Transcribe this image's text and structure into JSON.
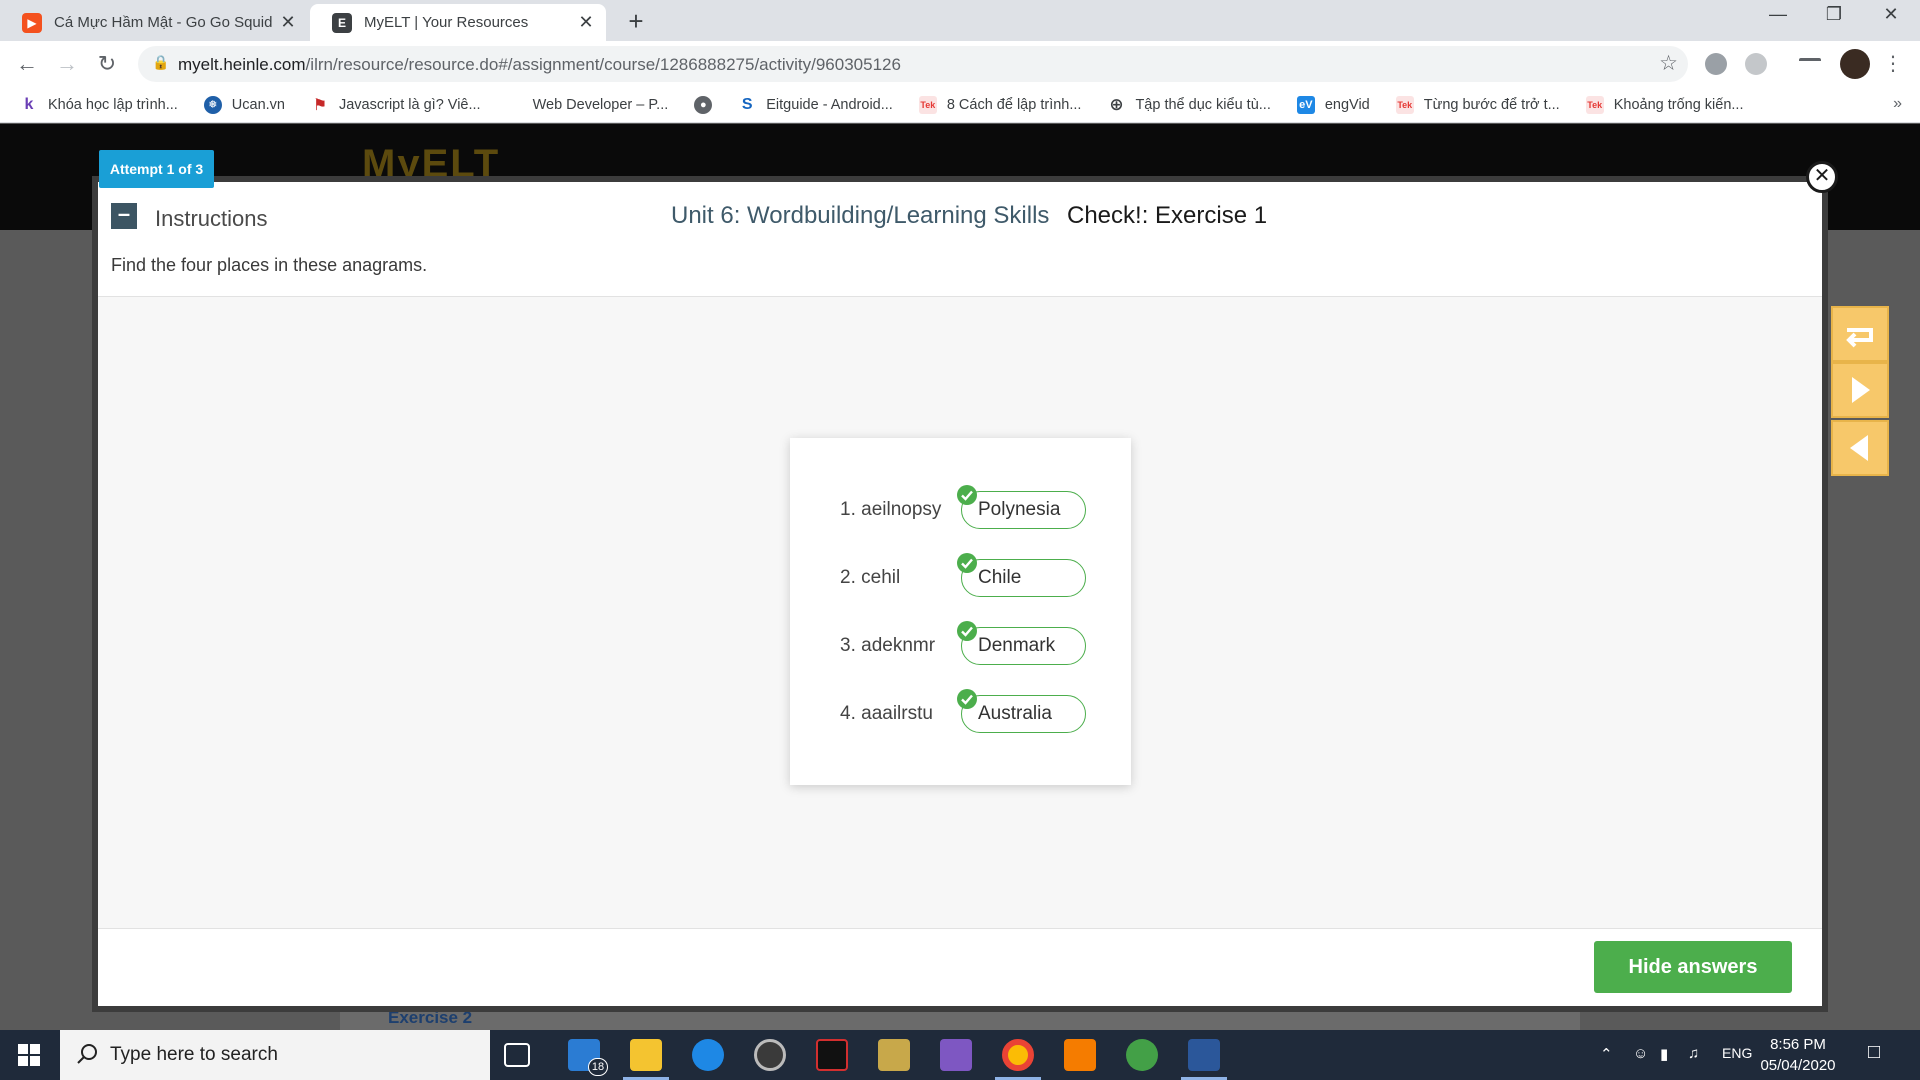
{
  "browser": {
    "tabs": [
      {
        "title": "Cá Mực Hầm Mật - Go Go Squid!",
        "active": false
      },
      {
        "title": "MyELT | Your Resources",
        "active": true
      }
    ],
    "url_host": "myelt.heinle.com",
    "url_path": "/ilrn/resource/resource.do#/assignment/course/1286888275/activity/960305126",
    "bookmarks": [
      {
        "label": "Khóa học lập trình...",
        "icon": "k-logo-icon",
        "color": "#6a3fb5"
      },
      {
        "label": "Ucan.vn",
        "icon": "globe-icon",
        "color": "#1f5fa8"
      },
      {
        "label": "Javascript là gì? Viê...",
        "icon": "flag-icon",
        "color": "#c62828"
      },
      {
        "label": "Web Developer – P...",
        "icon": "",
        "color": ""
      },
      {
        "label": "",
        "icon": "globe-icon",
        "color": "#5f6368"
      },
      {
        "label": "Eitguide - Android...",
        "icon": "s-logo-icon",
        "color": "#1565c0"
      },
      {
        "label": "8 Cách để lập trình...",
        "icon": "tek-logo-icon",
        "color": "#e53935"
      },
      {
        "label": "Tập thể dục kiểu tù...",
        "icon": "plus-circle-icon",
        "color": "#3c4043"
      },
      {
        "label": "engVid",
        "icon": "ev-logo-icon",
        "color": "#1e88e5"
      },
      {
        "label": "Từng bước để trở t...",
        "icon": "tek-logo-icon",
        "color": "#e53935"
      },
      {
        "label": "Khoảng trống kiến...",
        "icon": "tek-logo-icon",
        "color": "#e53935"
      }
    ]
  },
  "modal": {
    "attempt": "Attempt 1 of 3",
    "instructions_label": "Instructions",
    "unit_title": "Unit 6: Wordbuilding/Learning Skills",
    "exercise_title": "Check!: Exercise 1",
    "instruction_text": "Find the four places in these anagrams.",
    "items": [
      {
        "prompt": "1. aeilnopsy",
        "answer": "Polynesia",
        "correct": true
      },
      {
        "prompt": "2. cehil",
        "answer": "Chile",
        "correct": true
      },
      {
        "prompt": "3. adeknmr",
        "answer": "Denmark",
        "correct": true
      },
      {
        "prompt": "4. aaailrstu",
        "answer": "Australia",
        "correct": true
      }
    ],
    "hide_answers_label": "Hide answers"
  },
  "background_page": {
    "logo": "MyELT",
    "link": "Exercise 2"
  },
  "taskbar": {
    "search_placeholder": "Type here to search",
    "mail_badge": "18",
    "language": "ENG",
    "time": "8:56 PM",
    "date": "05/04/2020"
  },
  "colors": {
    "accent_blue": "#1a9fd6",
    "correct_green": "#4cae4c",
    "side_button_yellow": "#f7c86a"
  }
}
